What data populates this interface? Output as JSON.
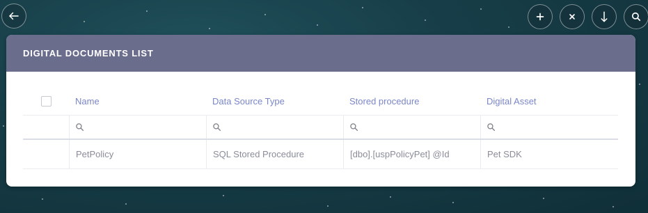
{
  "toolbar": {
    "back_icon": "arrow-left-icon",
    "add_icon": "plus-icon",
    "close_icon": "close-icon",
    "download_icon": "arrow-down-icon",
    "search_icon": "search-icon"
  },
  "card": {
    "title": "DIGITAL DOCUMENTS LIST"
  },
  "table": {
    "columns": [
      {
        "label": "Name"
      },
      {
        "label": "Data Source Type"
      },
      {
        "label": "Stored procedure"
      },
      {
        "label": "Digital Asset"
      }
    ],
    "rows": [
      [
        "PetPolicy",
        "SQL Stored Procedure",
        "[dbo].[uspPolicyPet] @Id",
        "Pet SDK"
      ]
    ]
  },
  "colors": {
    "header_bg": "#6b6d8c",
    "column_header_text": "#7a86c8",
    "cell_text": "#8a8d99"
  }
}
